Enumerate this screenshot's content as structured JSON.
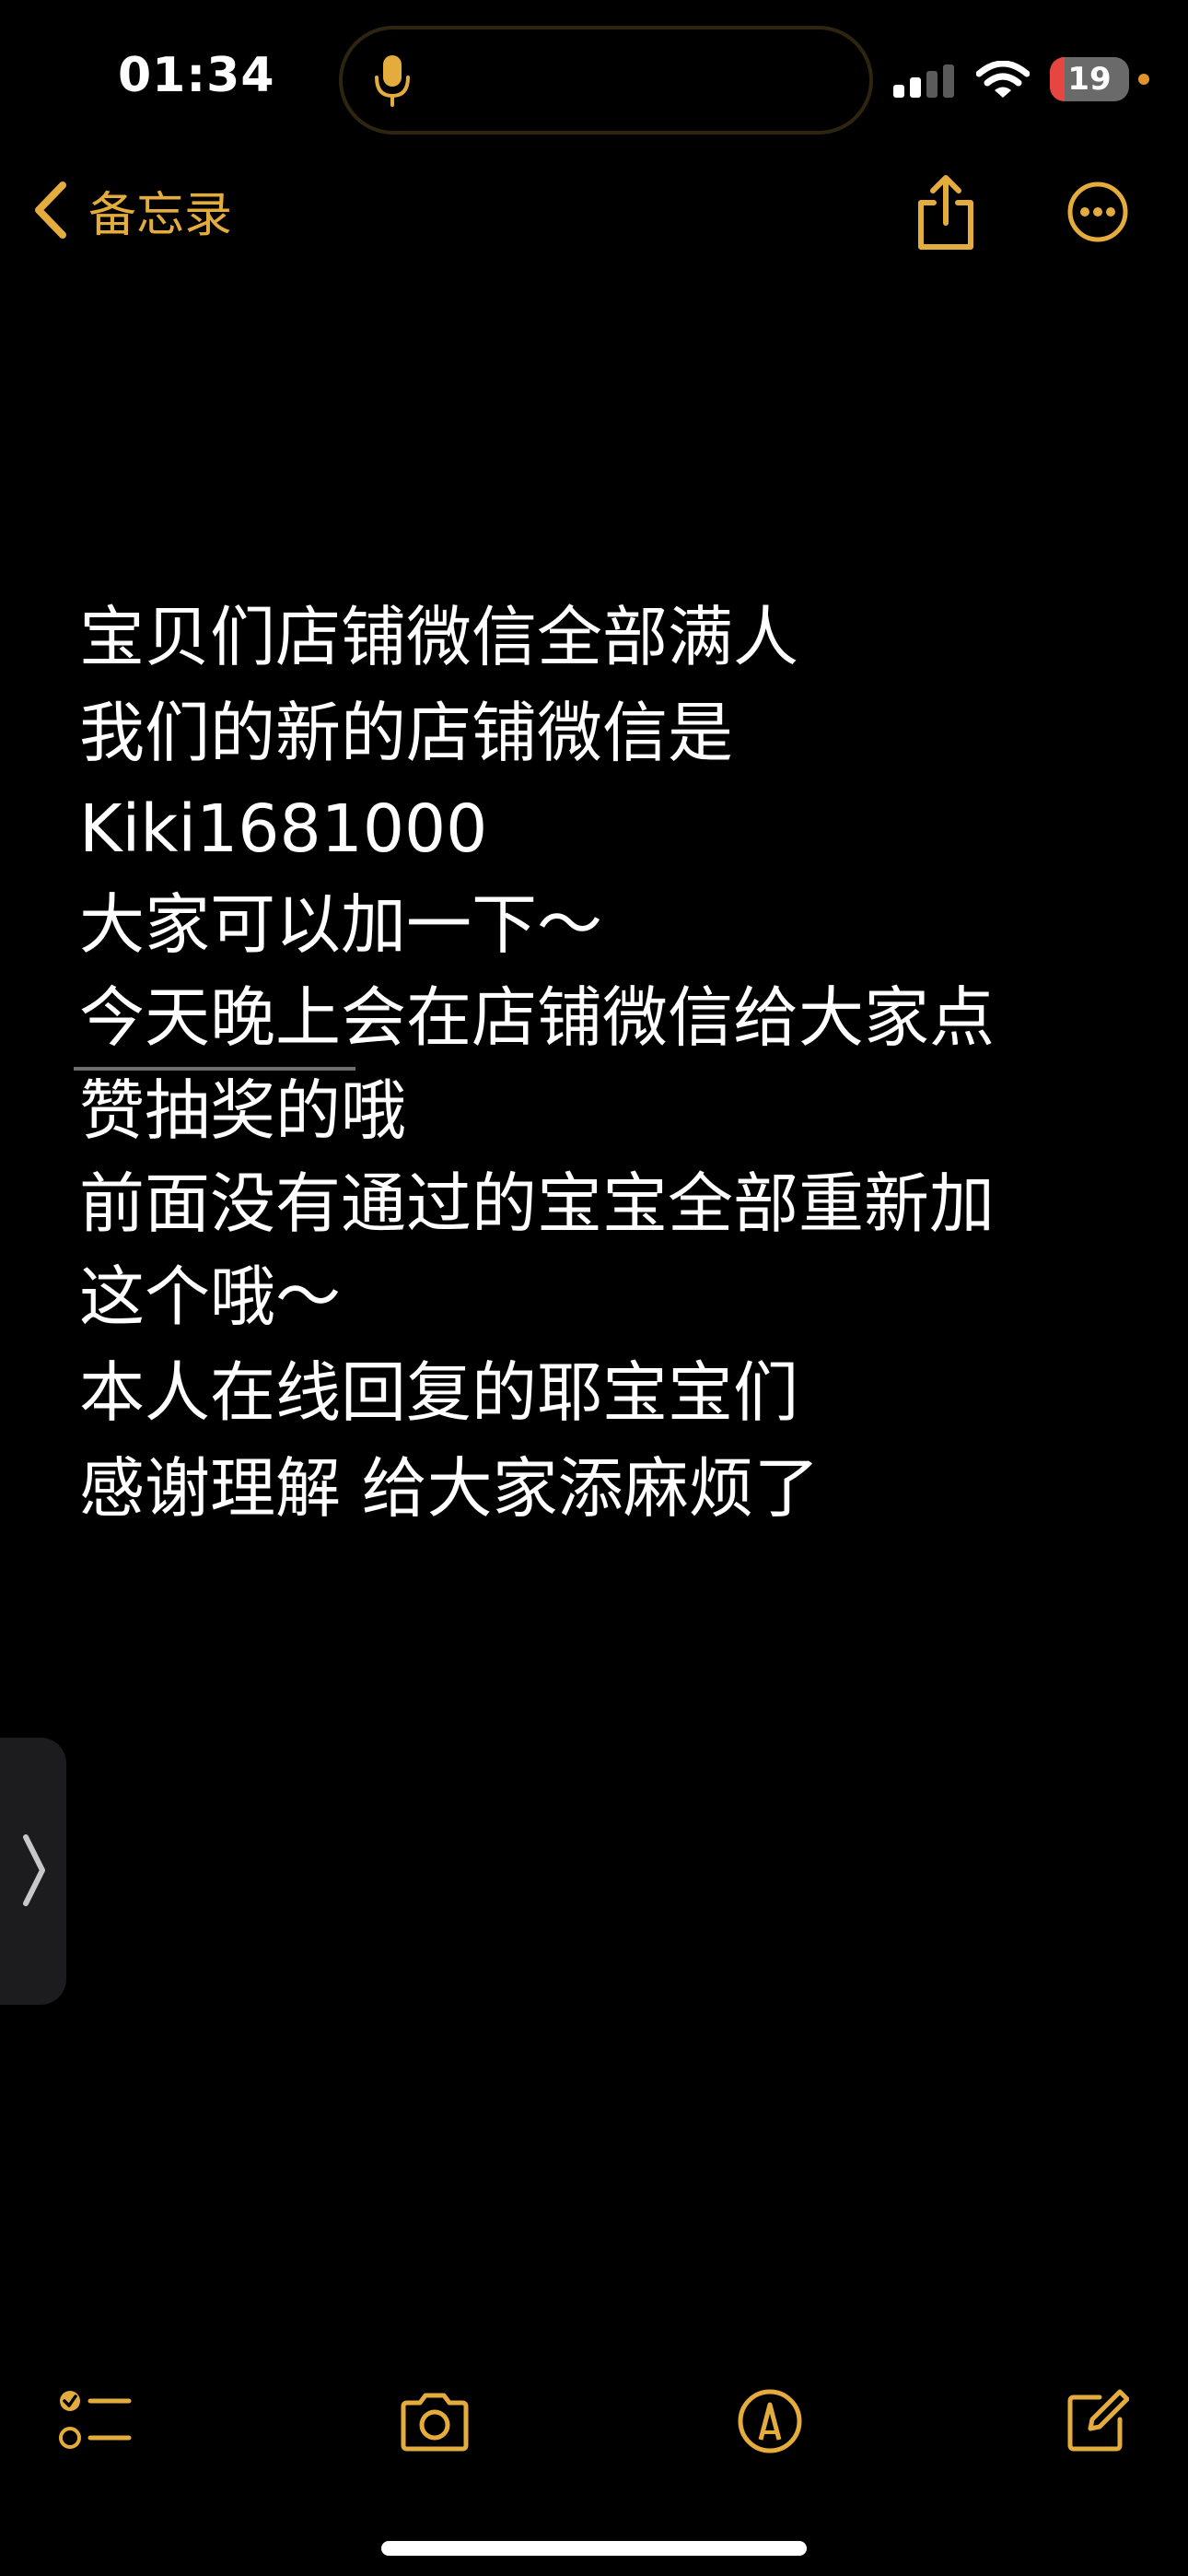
{
  "status_bar": {
    "time": "01:34",
    "battery_level": "19",
    "battery_fraction": 0.19
  },
  "nav": {
    "back_label": "备忘录",
    "back_icon": "chevron-left-icon",
    "share_icon": "share-icon",
    "more_icon": "ellipsis-circle-icon"
  },
  "note": {
    "lines": [
      "宝贝们店铺微信全部满人",
      "我们的新的店铺微信是",
      "Kiki1681000",
      "大家可以加一下～",
      "今天晚上会在店铺微信给大家点",
      "赞抽奖的哦",
      "前面没有通过的宝宝全部重新加",
      "这个哦～",
      "本人在线回复的耶宝宝们",
      "感谢理解 给大家添麻烦了"
    ]
  },
  "toolbar": {
    "checklist_icon": "checklist-icon",
    "camera_icon": "camera-icon",
    "markup_icon": "markup-pen-icon",
    "compose_icon": "compose-icon"
  },
  "colors": {
    "accent": "#e4ac3c",
    "background": "#000000",
    "text": "#ffffff",
    "battery_low": "#e84540"
  }
}
